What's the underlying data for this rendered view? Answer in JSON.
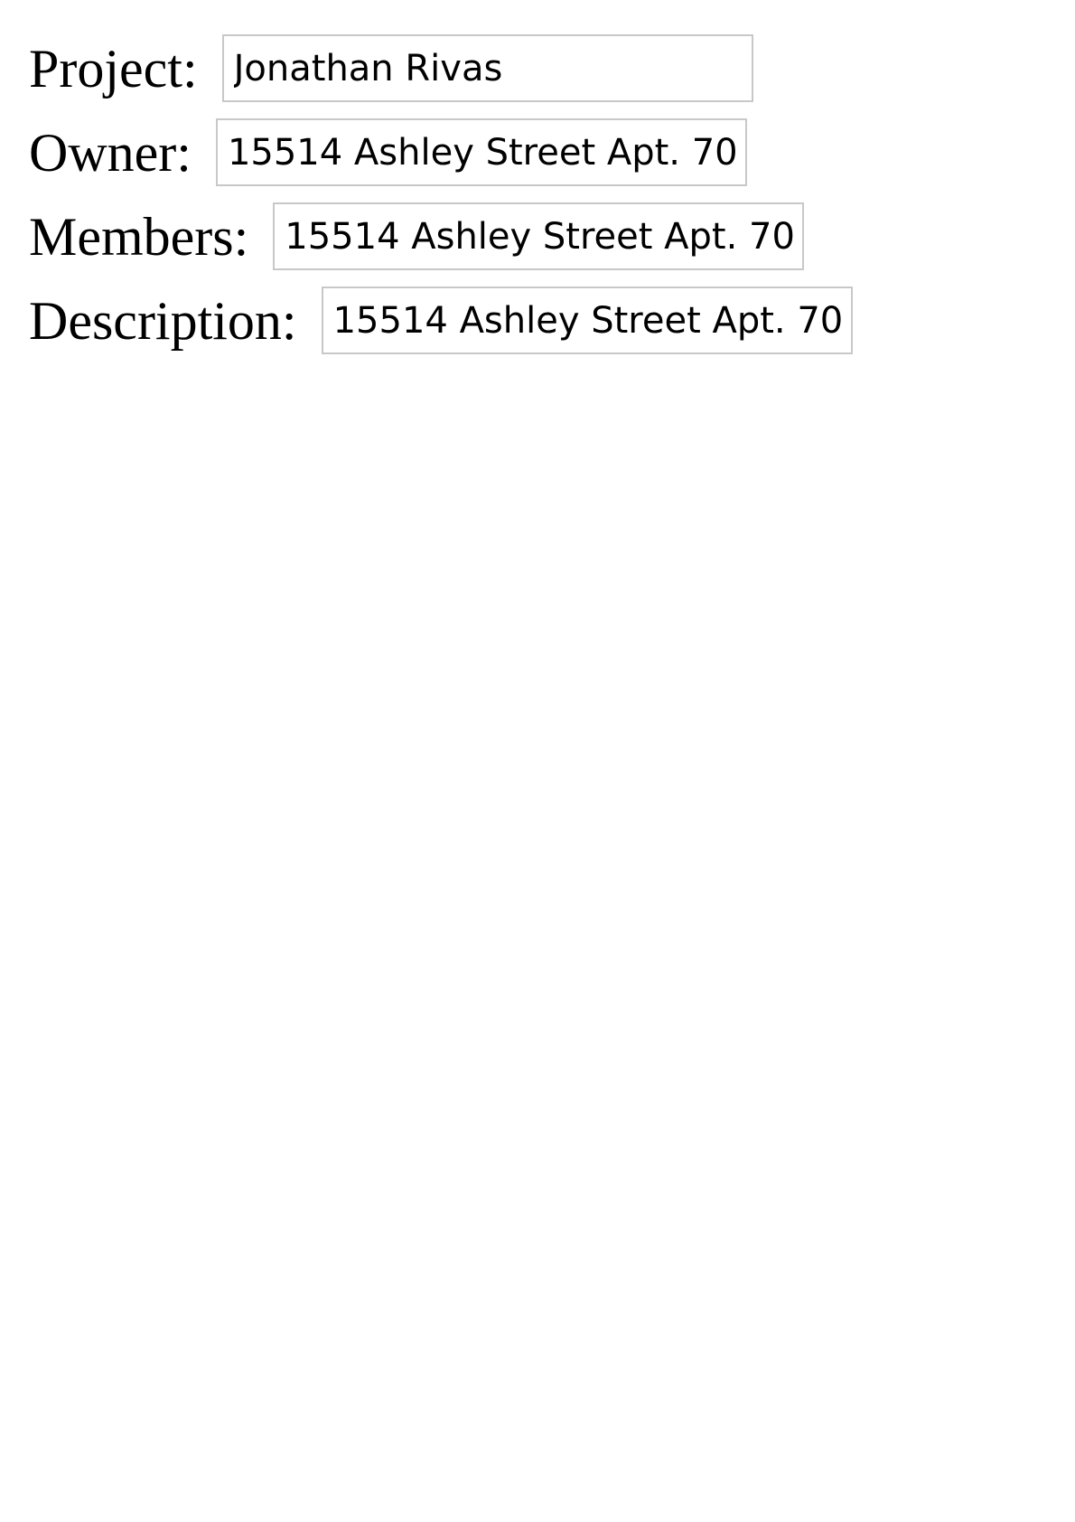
{
  "form": {
    "fields": [
      {
        "label": "Project:",
        "value": "Jonathan Rivas"
      },
      {
        "label": "Owner:",
        "value": "15514 Ashley Street Apt. 70"
      },
      {
        "label": "Members:",
        "value": "15514 Ashley Street Apt. 70"
      },
      {
        "label": "Description:",
        "value": "15514 Ashley Street Apt. 70"
      }
    ]
  }
}
